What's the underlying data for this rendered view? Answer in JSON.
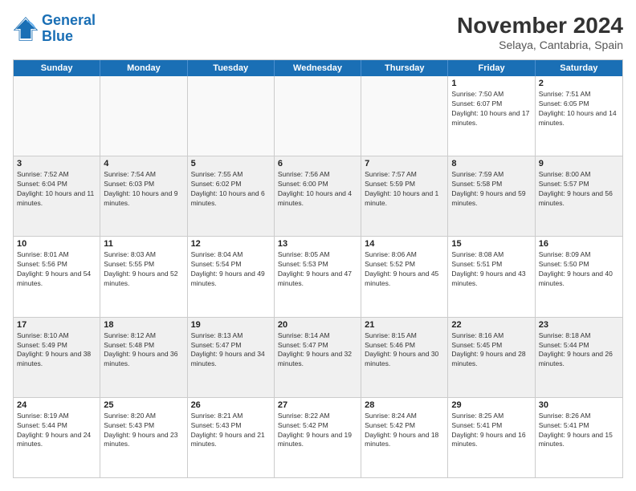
{
  "logo": {
    "line1": "General",
    "line2": "Blue"
  },
  "title": "November 2024",
  "location": "Selaya, Cantabria, Spain",
  "days_of_week": [
    "Sunday",
    "Monday",
    "Tuesday",
    "Wednesday",
    "Thursday",
    "Friday",
    "Saturday"
  ],
  "weeks": [
    [
      {
        "day": "",
        "info": ""
      },
      {
        "day": "",
        "info": ""
      },
      {
        "day": "",
        "info": ""
      },
      {
        "day": "",
        "info": ""
      },
      {
        "day": "",
        "info": ""
      },
      {
        "day": "1",
        "info": "Sunrise: 7:50 AM\nSunset: 6:07 PM\nDaylight: 10 hours and 17 minutes."
      },
      {
        "day": "2",
        "info": "Sunrise: 7:51 AM\nSunset: 6:05 PM\nDaylight: 10 hours and 14 minutes."
      }
    ],
    [
      {
        "day": "3",
        "info": "Sunrise: 7:52 AM\nSunset: 6:04 PM\nDaylight: 10 hours and 11 minutes."
      },
      {
        "day": "4",
        "info": "Sunrise: 7:54 AM\nSunset: 6:03 PM\nDaylight: 10 hours and 9 minutes."
      },
      {
        "day": "5",
        "info": "Sunrise: 7:55 AM\nSunset: 6:02 PM\nDaylight: 10 hours and 6 minutes."
      },
      {
        "day": "6",
        "info": "Sunrise: 7:56 AM\nSunset: 6:00 PM\nDaylight: 10 hours and 4 minutes."
      },
      {
        "day": "7",
        "info": "Sunrise: 7:57 AM\nSunset: 5:59 PM\nDaylight: 10 hours and 1 minute."
      },
      {
        "day": "8",
        "info": "Sunrise: 7:59 AM\nSunset: 5:58 PM\nDaylight: 9 hours and 59 minutes."
      },
      {
        "day": "9",
        "info": "Sunrise: 8:00 AM\nSunset: 5:57 PM\nDaylight: 9 hours and 56 minutes."
      }
    ],
    [
      {
        "day": "10",
        "info": "Sunrise: 8:01 AM\nSunset: 5:56 PM\nDaylight: 9 hours and 54 minutes."
      },
      {
        "day": "11",
        "info": "Sunrise: 8:03 AM\nSunset: 5:55 PM\nDaylight: 9 hours and 52 minutes."
      },
      {
        "day": "12",
        "info": "Sunrise: 8:04 AM\nSunset: 5:54 PM\nDaylight: 9 hours and 49 minutes."
      },
      {
        "day": "13",
        "info": "Sunrise: 8:05 AM\nSunset: 5:53 PM\nDaylight: 9 hours and 47 minutes."
      },
      {
        "day": "14",
        "info": "Sunrise: 8:06 AM\nSunset: 5:52 PM\nDaylight: 9 hours and 45 minutes."
      },
      {
        "day": "15",
        "info": "Sunrise: 8:08 AM\nSunset: 5:51 PM\nDaylight: 9 hours and 43 minutes."
      },
      {
        "day": "16",
        "info": "Sunrise: 8:09 AM\nSunset: 5:50 PM\nDaylight: 9 hours and 40 minutes."
      }
    ],
    [
      {
        "day": "17",
        "info": "Sunrise: 8:10 AM\nSunset: 5:49 PM\nDaylight: 9 hours and 38 minutes."
      },
      {
        "day": "18",
        "info": "Sunrise: 8:12 AM\nSunset: 5:48 PM\nDaylight: 9 hours and 36 minutes."
      },
      {
        "day": "19",
        "info": "Sunrise: 8:13 AM\nSunset: 5:47 PM\nDaylight: 9 hours and 34 minutes."
      },
      {
        "day": "20",
        "info": "Sunrise: 8:14 AM\nSunset: 5:47 PM\nDaylight: 9 hours and 32 minutes."
      },
      {
        "day": "21",
        "info": "Sunrise: 8:15 AM\nSunset: 5:46 PM\nDaylight: 9 hours and 30 minutes."
      },
      {
        "day": "22",
        "info": "Sunrise: 8:16 AM\nSunset: 5:45 PM\nDaylight: 9 hours and 28 minutes."
      },
      {
        "day": "23",
        "info": "Sunrise: 8:18 AM\nSunset: 5:44 PM\nDaylight: 9 hours and 26 minutes."
      }
    ],
    [
      {
        "day": "24",
        "info": "Sunrise: 8:19 AM\nSunset: 5:44 PM\nDaylight: 9 hours and 24 minutes."
      },
      {
        "day": "25",
        "info": "Sunrise: 8:20 AM\nSunset: 5:43 PM\nDaylight: 9 hours and 23 minutes."
      },
      {
        "day": "26",
        "info": "Sunrise: 8:21 AM\nSunset: 5:43 PM\nDaylight: 9 hours and 21 minutes."
      },
      {
        "day": "27",
        "info": "Sunrise: 8:22 AM\nSunset: 5:42 PM\nDaylight: 9 hours and 19 minutes."
      },
      {
        "day": "28",
        "info": "Sunrise: 8:24 AM\nSunset: 5:42 PM\nDaylight: 9 hours and 18 minutes."
      },
      {
        "day": "29",
        "info": "Sunrise: 8:25 AM\nSunset: 5:41 PM\nDaylight: 9 hours and 16 minutes."
      },
      {
        "day": "30",
        "info": "Sunrise: 8:26 AM\nSunset: 5:41 PM\nDaylight: 9 hours and 15 minutes."
      }
    ]
  ]
}
